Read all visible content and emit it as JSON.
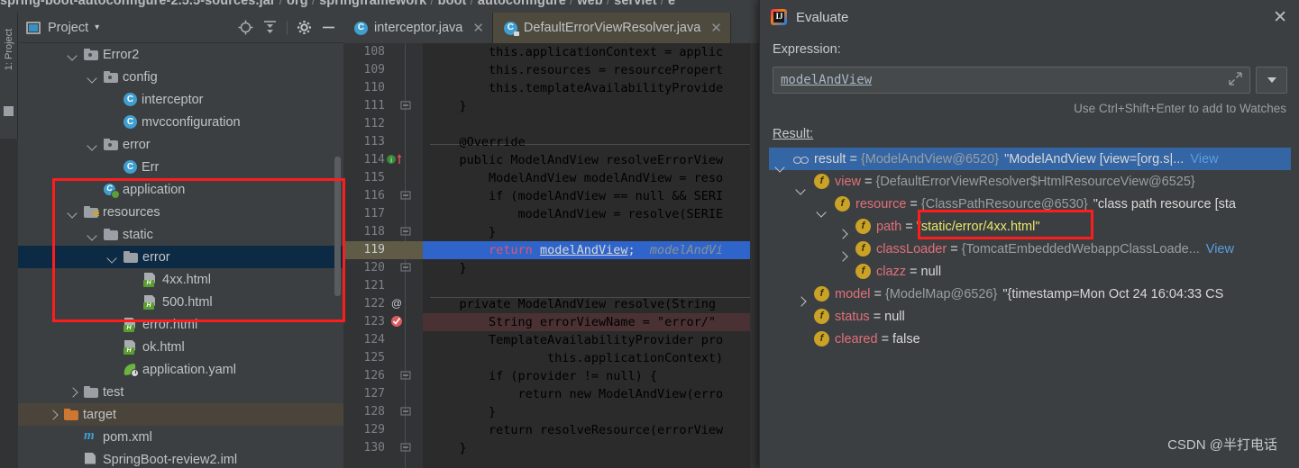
{
  "breadcrumb": {
    "text": "spring-boot-autoconfigure-2.5.5-sources.jar",
    "parts": [
      "org",
      "springframework",
      "boot",
      "autoconfigure",
      "web",
      "servlet",
      "e"
    ]
  },
  "left_strip": {
    "label": "1: Project"
  },
  "project_panel": {
    "title": "Project",
    "caret": "▾",
    "icons": [
      "locate-icon",
      "collapse-all-icon",
      "settings-gear-icon",
      "hide-icon"
    ],
    "tree": [
      {
        "label": "Error2",
        "icon": "folder-source-icon",
        "arrow": "down",
        "indent": 2,
        "state": "normal"
      },
      {
        "label": "config",
        "icon": "folder-source-icon",
        "arrow": "down",
        "indent": 3,
        "state": "normal"
      },
      {
        "label": "interceptor",
        "icon": "java-class-icon",
        "arrow": "none",
        "indent": 4,
        "state": "normal"
      },
      {
        "label": "mvcconfiguration",
        "icon": "java-class-icon",
        "arrow": "none",
        "indent": 4,
        "state": "normal"
      },
      {
        "label": "error",
        "icon": "folder-source-icon",
        "arrow": "down",
        "indent": 3,
        "state": "normal"
      },
      {
        "label": "Err",
        "icon": "java-class-icon",
        "arrow": "none",
        "indent": 4,
        "state": "normal"
      },
      {
        "label": "application",
        "icon": "spring-app-icon",
        "arrow": "none",
        "indent": 3,
        "state": "normal"
      },
      {
        "label": "resources",
        "icon": "folder-resources-icon",
        "arrow": "down",
        "indent": 2,
        "state": "normal"
      },
      {
        "label": "static",
        "icon": "folder-icon",
        "arrow": "down",
        "indent": 3,
        "state": "normal"
      },
      {
        "label": "error",
        "icon": "folder-icon",
        "arrow": "down",
        "indent": 4,
        "state": "selected"
      },
      {
        "label": "4xx.html",
        "icon": "html-file-icon",
        "arrow": "none",
        "indent": 5,
        "state": "normal"
      },
      {
        "label": "500.html",
        "icon": "html-file-icon",
        "arrow": "none",
        "indent": 5,
        "state": "normal"
      },
      {
        "label": "error.html",
        "icon": "html-file-icon",
        "arrow": "none",
        "indent": 4,
        "state": "normal"
      },
      {
        "label": "ok.html",
        "icon": "html-file-icon",
        "arrow": "none",
        "indent": 4,
        "state": "normal"
      },
      {
        "label": "application.yaml",
        "icon": "yaml-file-icon",
        "arrow": "none",
        "indent": 4,
        "state": "normal"
      },
      {
        "label": "test",
        "icon": "folder-icon",
        "arrow": "right",
        "indent": 2,
        "state": "normal"
      },
      {
        "label": "target",
        "icon": "folder-target-icon",
        "arrow": "right",
        "indent": 1,
        "state": "target"
      },
      {
        "label": "pom.xml",
        "icon": "maven-file-icon",
        "arrow": "none",
        "indent": 2,
        "state": "normal"
      },
      {
        "label": "SpringBoot-review2.iml",
        "icon": "iml-file-icon",
        "arrow": "none",
        "indent": 2,
        "state": "normal"
      }
    ]
  },
  "editor": {
    "tabs": [
      {
        "label": "interceptor.java",
        "icon": "java-class-icon",
        "active": false,
        "close": "✕"
      },
      {
        "label": "DefaultErrorViewResolver.java",
        "icon": "java-class-readonly-icon",
        "active": true,
        "close": "✕"
      }
    ],
    "lines": [
      {
        "n": "108",
        "gutter": "",
        "text": "        this.applicationContext = applic"
      },
      {
        "n": "109",
        "gutter": "",
        "text": "        this.resources = resourcePropert"
      },
      {
        "n": "110",
        "gutter": "",
        "text": "        this.templateAvailabilityProvide"
      },
      {
        "n": "111",
        "gutter": "fold-end",
        "text": "    }"
      },
      {
        "n": "112",
        "gutter": "",
        "text": ""
      },
      {
        "n": "113",
        "gutter": "",
        "text": "    @Override"
      },
      {
        "n": "114",
        "gutter": "override-impl",
        "text": "    public ModelAndView resolveErrorView"
      },
      {
        "n": "115",
        "gutter": "",
        "text": "        ModelAndView modelAndView = reso"
      },
      {
        "n": "116",
        "gutter": "fold-end",
        "text": "        if (modelAndView == null && SERI"
      },
      {
        "n": "117",
        "gutter": "",
        "text": "            modelAndView = resolve(SERIE"
      },
      {
        "n": "118",
        "gutter": "fold-end",
        "text": "        }"
      },
      {
        "n": "119",
        "gutter": "",
        "text": "        return modelAndView;   modelAndVi"
      },
      {
        "n": "120",
        "gutter": "fold-end",
        "text": "    }"
      },
      {
        "n": "121",
        "gutter": "",
        "text": ""
      },
      {
        "n": "122",
        "gutter": "annotation",
        "text": "    private ModelAndView resolve(String"
      },
      {
        "n": "123",
        "gutter": "breakpoint",
        "text": "        String errorViewName = \"error/\""
      },
      {
        "n": "124",
        "gutter": "",
        "text": "        TemplateAvailabilityProvider pro"
      },
      {
        "n": "125",
        "gutter": "",
        "text": "                this.applicationContext)"
      },
      {
        "n": "126",
        "gutter": "fold-end",
        "text": "        if (provider != null) {"
      },
      {
        "n": "127",
        "gutter": "",
        "text": "            return new ModelAndView(erro"
      },
      {
        "n": "128",
        "gutter": "fold-end",
        "text": "        }"
      },
      {
        "n": "129",
        "gutter": "",
        "text": "        return resolveResource(errorView"
      },
      {
        "n": "130",
        "gutter": "fold-end",
        "text": "    }"
      }
    ]
  },
  "evaluate_dialog": {
    "title": "Evaluate",
    "app_icon": "intellij-idea-icon",
    "close_label": "✕",
    "expression_label": "Expression:",
    "expression_value": "modelAndView",
    "expression_expand_icon": "expand-icon",
    "expression_dropdown_icon": "chevron-down-icon",
    "watch_hint": "Use Ctrl+Shift+Enter to add to Watches",
    "result_label": "Result:",
    "result_tree": [
      {
        "indent": 0,
        "arrow": "down",
        "icon": "result-icon",
        "name": "result",
        "eq": "=",
        "type": "{ModelAndView@6520}",
        "value": "\"ModelAndView [view=[org.s|... ",
        "link": "View",
        "selected": true,
        "value_style": "plain"
      },
      {
        "indent": 1,
        "arrow": "down",
        "icon": "field-icon",
        "name": "view",
        "eq": "=",
        "type": "{DefaultErrorViewResolver$HtmlResourceView@6525}",
        "value": "",
        "link": "",
        "selected": false,
        "value_style": "plain"
      },
      {
        "indent": 2,
        "arrow": "down",
        "icon": "field-icon",
        "name": "resource",
        "eq": "=",
        "type": "{ClassPathResource@6530}",
        "value": "\"class path resource [sta",
        "link": "",
        "selected": false,
        "value_style": "plain"
      },
      {
        "indent": 3,
        "arrow": "right",
        "icon": "field-icon",
        "name": "path",
        "eq": "=",
        "type": "",
        "value": "\"static/error/4xx.html\"",
        "link": "",
        "selected": false,
        "value_style": "yellow"
      },
      {
        "indent": 3,
        "arrow": "right",
        "icon": "field-icon",
        "name": "classLoader",
        "eq": "=",
        "type": "{TomcatEmbeddedWebappClassLoade...",
        "value": "",
        "link": "View",
        "selected": false,
        "value_style": "plain"
      },
      {
        "indent": 3,
        "arrow": "none",
        "icon": "field-icon",
        "name": "clazz",
        "eq": "=",
        "type": "",
        "value": "null",
        "link": "",
        "selected": false,
        "value_style": "plain"
      },
      {
        "indent": 1,
        "arrow": "right",
        "icon": "field-icon",
        "name": "model",
        "eq": "=",
        "type": "{ModelMap@6526}",
        "value": "\"{timestamp=Mon Oct 24 16:04:33 CS",
        "link": "",
        "selected": false,
        "value_style": "plain"
      },
      {
        "indent": 1,
        "arrow": "none",
        "icon": "field-icon",
        "name": "status",
        "eq": "=",
        "type": "",
        "value": "null",
        "link": "",
        "selected": false,
        "value_style": "plain"
      },
      {
        "indent": 1,
        "arrow": "none",
        "icon": "field-icon",
        "name": "cleared",
        "eq": "=",
        "type": "",
        "value": "false",
        "link": "",
        "selected": false,
        "value_style": "plain"
      }
    ]
  },
  "annotations": {
    "project_highlight_box": "red-rectangle-around-static-error-folder",
    "path_highlight_box": "red-rectangle-around-path-value"
  },
  "watermark": {
    "text": "CSDN @半打电话"
  },
  "colors": {
    "accent_blue": "#3465a4",
    "selection_blue": "#2f65ca",
    "annotation_red": "#fd1d1d",
    "panel_bg": "#3c3f41",
    "editor_bg": "#2b2b2b",
    "tab_active": "#4e4a3e"
  }
}
